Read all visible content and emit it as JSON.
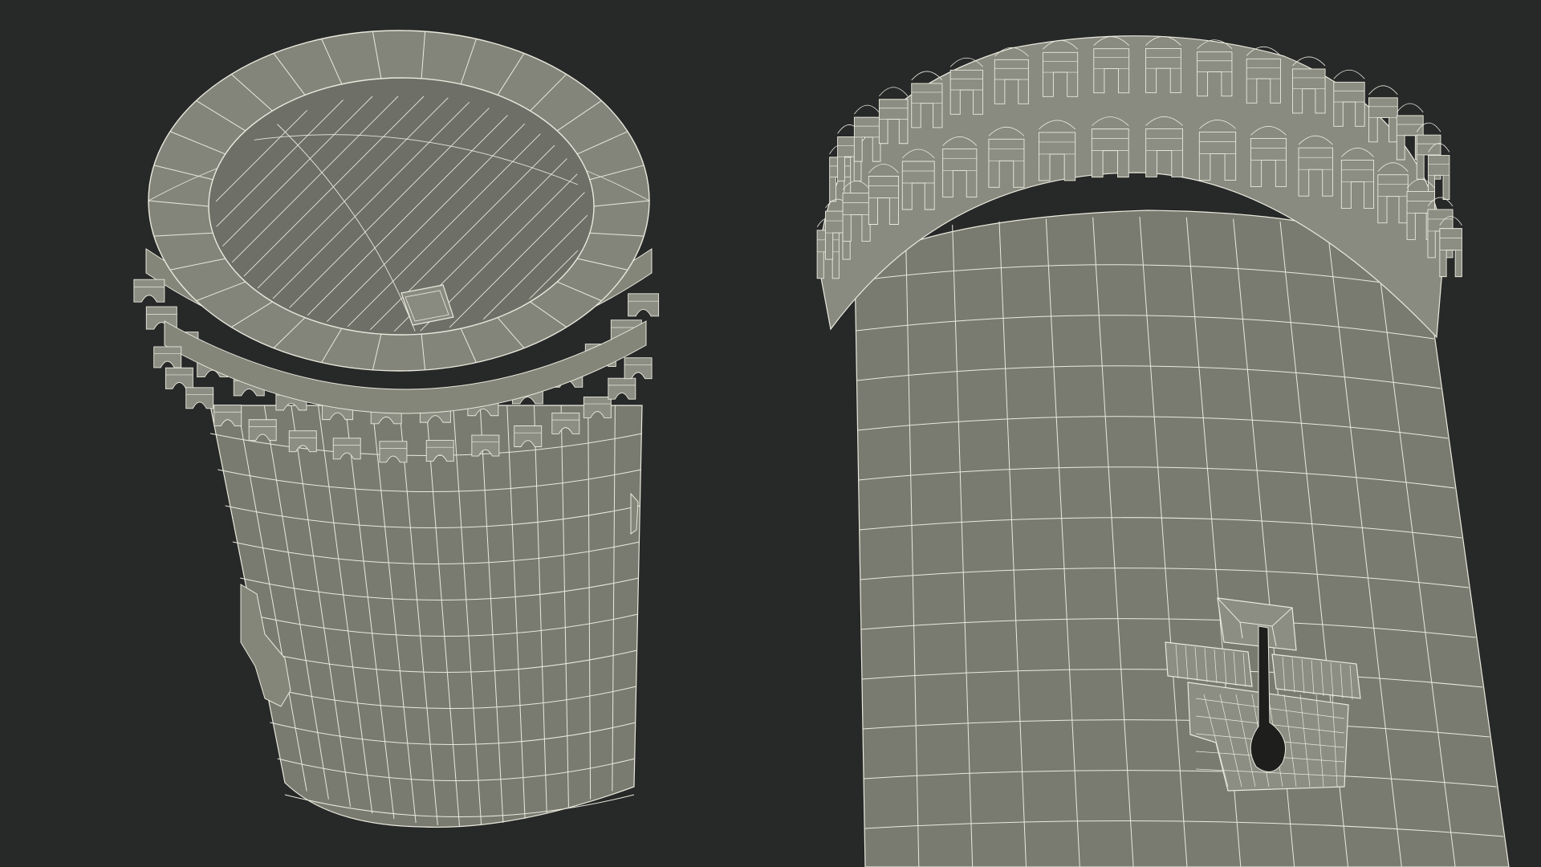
{
  "scene": {
    "background": "#272828",
    "mesh_fill": "#7a7b70",
    "mesh_fill_dark": "#6c6d63",
    "interior_fill": "#6e6f66",
    "wire_color": "#e9e9de",
    "slot_color": "#1e1f1d"
  },
  "views": [
    {
      "name": "tower-top-view",
      "description_visible": ""
    },
    {
      "name": "tower-closeup-view",
      "description_visible": ""
    }
  ]
}
